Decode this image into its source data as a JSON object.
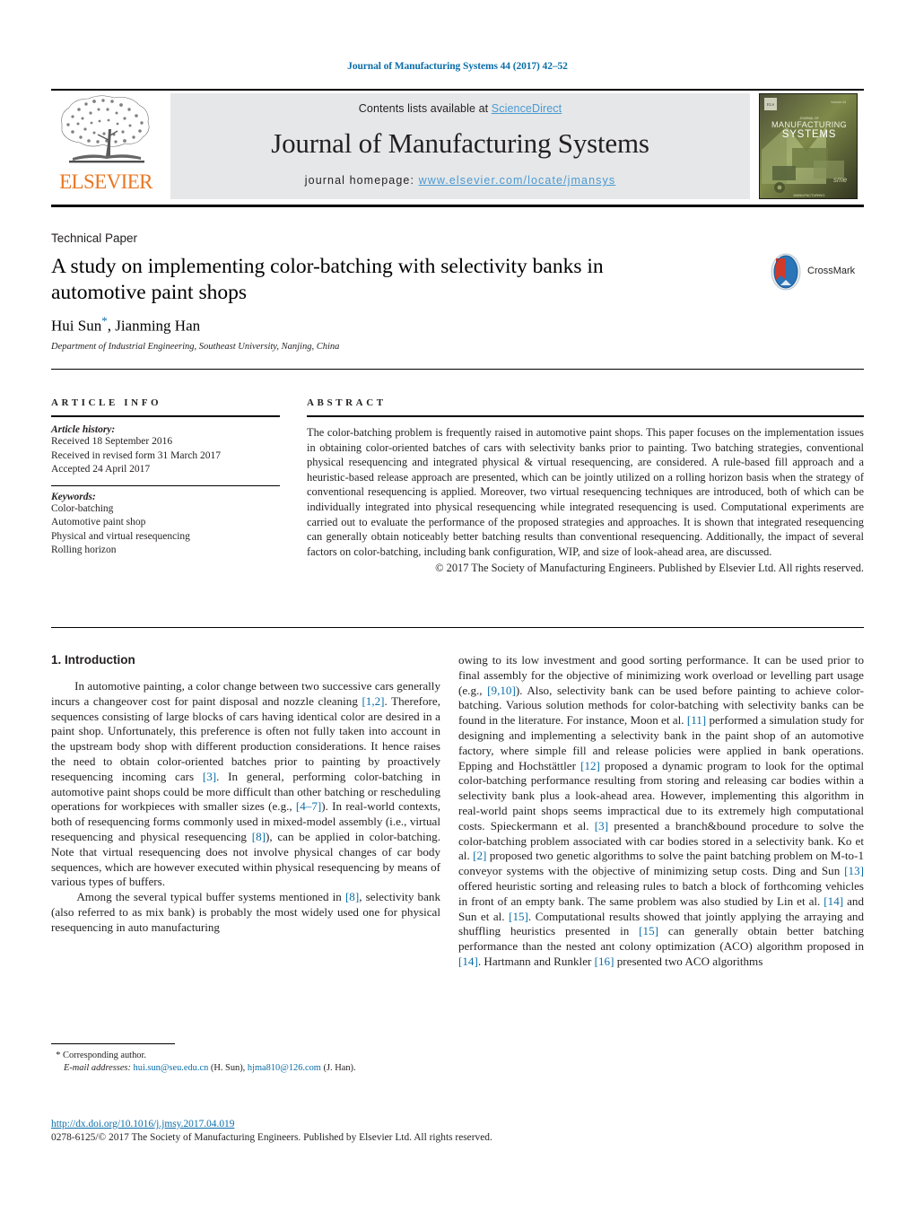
{
  "running_head": "Journal of Manufacturing Systems 44 (2017) 42–52",
  "masthead": {
    "contents_prefix": "Contents lists available at ",
    "sciencedirect": "ScienceDirect",
    "journal_title": "Journal of Manufacturing Systems",
    "homepage_prefix": "journal homepage: ",
    "homepage_url": "www.elsevier.com/locate/jmansys",
    "publisher_wordmark": "ELSEVIER",
    "cover_line1": "JOURNAL OF",
    "cover_line2": "MANUFACTURING",
    "cover_line3": "SYSTEMS",
    "cover_badge": "sme"
  },
  "title_block": {
    "paper_type": "Technical Paper",
    "title": "A study on implementing color-batching with selectivity banks in automotive paint shops",
    "authors": "Hui Sun",
    "corresponding_marker": "*",
    "authors_rest": ", Jianming Han",
    "affiliation": "Department of Industrial Engineering, Southeast University, Nanjing, China",
    "crossmark_label": "CrossMark"
  },
  "article_info": {
    "heading": "ARTICLE INFO",
    "history_label": "Article history:",
    "history": [
      "Received 18 September 2016",
      "Received in revised form 31 March 2017",
      "Accepted 24 April 2017"
    ],
    "keywords_label": "Keywords:",
    "keywords": [
      "Color-batching",
      "Automotive paint shop",
      "Physical and virtual resequencing",
      "Rolling horizon"
    ]
  },
  "abstract": {
    "heading": "ABSTRACT",
    "text": "The color-batching problem is frequently raised in automotive paint shops. This paper focuses on the implementation issues in obtaining color-oriented batches of cars with selectivity banks prior to painting. Two batching strategies, conventional physical resequencing and integrated physical & virtual resequencing, are considered. A rule-based fill approach and a heuristic-based release approach are presented, which can be jointly utilized on a rolling horizon basis when the strategy of conventional resequencing is applied. Moreover, two virtual resequencing techniques are introduced, both of which can be individually integrated into physical resequencing while integrated resequencing is used. Computational experiments are carried out to evaluate the performance of the proposed strategies and approaches. It is shown that integrated resequencing can generally obtain noticeably better batching results than conventional resequencing. Additionally, the impact of several factors on color-batching, including bank configuration, WIP, and size of look-ahead area, are discussed.",
    "copyright": "© 2017 The Society of Manufacturing Engineers. Published by Elsevier Ltd. All rights reserved."
  },
  "section": {
    "number_and_title": "1. Introduction",
    "left_paragraphs": [
      "In automotive painting, a color change between two successive cars generally incurs a changeover cost for paint disposal and nozzle cleaning [1,2]. Therefore, sequences consisting of large blocks of cars having identical color are desired in a paint shop. Unfortunately, this preference is often not fully taken into account in the upstream body shop with different production considerations. It hence raises the need to obtain color-oriented batches prior to painting by proactively resequencing incoming cars [3]. In general, performing color-batching in automotive paint shops could be more difficult than other batching or rescheduling operations for workpieces with smaller sizes (e.g., [4–7]). In real-world contexts, both of resequencing forms commonly used in mixed-model assembly (i.e., virtual resequencing and physical resequencing [8]), can be applied in color-batching. Note that virtual resequencing does not involve physical changes of car body sequences, which are however executed within physical resequencing by means of various types of buffers.",
      "Among the several typical buffer systems mentioned in [8], selectivity bank (also referred to as mix bank) is probably the most widely used one for physical resequencing in auto manufacturing"
    ],
    "right_paragraphs": [
      "owing to its low investment and good sorting performance. It can be used prior to final assembly for the objective of minimizing work overload or levelling part usage (e.g., [9,10]). Also, selectivity bank can be used before painting to achieve color-batching. Various solution methods for color-batching with selectivity banks can be found in the literature. For instance, Moon et al. [11] performed a simulation study for designing and implementing a selectivity bank in the paint shop of an automotive factory, where simple fill and release policies were applied in bank operations. Epping and Hochstättler [12] proposed a dynamic program to look for the optimal color-batching performance resulting from storing and releasing car bodies within a selectivity bank plus a look-ahead area. However, implementing this algorithm in real-world paint shops seems impractical due to its extremely high computational costs. Spieckermann et al. [3] presented a branch&bound procedure to solve the color-batching problem associated with car bodies stored in a selectivity bank. Ko et al. [2] proposed two genetic algorithms to solve the paint batching problem on M-to-1 conveyor systems with the objective of minimizing setup costs. Ding and Sun [13] offered heuristic sorting and releasing rules to batch a block of forthcoming vehicles in front of an empty bank. The same problem was also studied by Lin et al. [14] and Sun et al. [15]. Computational results showed that jointly applying the arraying and shuffling heuristics presented in [15] can generally obtain better batching performance than the nested ant colony optimization (ACO) algorithm proposed in [14]. Hartmann and Runkler [16] presented two ACO algorithms"
    ]
  },
  "footnote": {
    "corresponding_star": "*",
    "corresponding_text": "Corresponding author.",
    "email_label": "E-mail addresses:",
    "email1": "hui.sun@seu.edu.cn",
    "email1_owner": "(H. Sun),",
    "email2": "hjma810@126.com",
    "email2_owner": "(J. Han)."
  },
  "doi_block": {
    "doi_url": "http://dx.doi.org/10.1016/j.jmsy.2017.04.019",
    "issn_line": "0278-6125/© 2017 The Society of Manufacturing Engineers. Published by Elsevier Ltd. All rights reserved."
  },
  "colors": {
    "link_blue": "#0b6ea8",
    "masthead_blue": "#4a9ad4",
    "elsevier_orange": "#E87722",
    "band_gray": "#e6e7e8"
  }
}
